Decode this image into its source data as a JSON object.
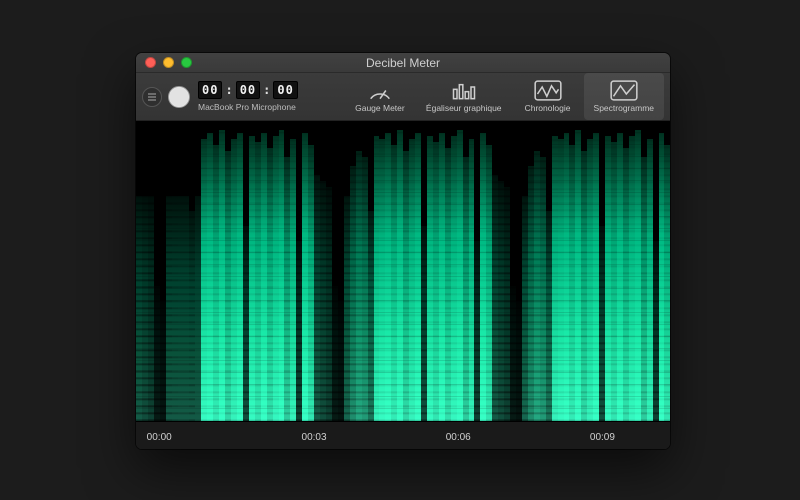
{
  "window": {
    "title": "Decibel Meter"
  },
  "toolbar": {
    "timer": {
      "hh": "00",
      "mm": "00",
      "ss": "00",
      "sep": ":"
    },
    "source_label": "MacBook Pro Microphone"
  },
  "tabs": [
    {
      "id": "gauge",
      "label": "Gauge Meter",
      "icon": "gauge-icon",
      "active": false
    },
    {
      "id": "equalizer",
      "label": "Égaliseur graphique",
      "icon": "bars-icon",
      "active": false
    },
    {
      "id": "chronology",
      "label": "Chronologie",
      "icon": "wave-icon",
      "active": false
    },
    {
      "id": "spectrogram",
      "label": "Spectrogramme",
      "icon": "spectro-icon",
      "active": true
    }
  ],
  "timeline": {
    "ticks": [
      {
        "label": "00:00",
        "pos_pct": 2
      },
      {
        "label": "00:03",
        "pos_pct": 31
      },
      {
        "label": "00:06",
        "pos_pct": 58
      },
      {
        "label": "00:09",
        "pos_pct": 85
      }
    ]
  },
  "spectrogram": {
    "columns": 90,
    "pattern": [
      {
        "cut": 18,
        "a": 0.35,
        "n": 0.5
      },
      {
        "cut": 20,
        "a": 0.3,
        "n": 0.55
      },
      {
        "cut": 22,
        "a": 0.25,
        "n": 0.6
      },
      {
        "cut": 55,
        "a": 0.1,
        "n": 0.7
      },
      {
        "cut": 60,
        "a": 0.08,
        "n": 0.75
      },
      {
        "cut": 25,
        "a": 0.4,
        "n": 0.45
      },
      {
        "cut": 15,
        "a": 0.55,
        "n": 0.35
      },
      {
        "cut": 10,
        "a": 0.65,
        "n": 0.3
      },
      {
        "cut": 12,
        "a": 0.6,
        "n": 0.3
      },
      {
        "cut": 30,
        "a": 0.45,
        "n": 0.4
      },
      {
        "cut": 5,
        "a": 0.95,
        "n": 0.15
      },
      {
        "cut": 6,
        "a": 0.98,
        "n": 0.12
      },
      {
        "cut": 4,
        "a": 1.0,
        "n": 0.1
      },
      {
        "cut": 8,
        "a": 0.92,
        "n": 0.15
      },
      {
        "cut": 3,
        "a": 1.0,
        "n": 0.08
      },
      {
        "cut": 10,
        "a": 0.85,
        "n": 0.2
      },
      {
        "cut": 6,
        "a": 0.95,
        "n": 0.12
      },
      {
        "cut": 4,
        "a": 1.0,
        "n": 0.1
      },
      {
        "cut": 35,
        "a": 0.3,
        "n": 0.5
      },
      {
        "cut": 5,
        "a": 0.98,
        "n": 0.1
      },
      {
        "cut": 7,
        "a": 0.9,
        "n": 0.15
      },
      {
        "cut": 4,
        "a": 1.0,
        "n": 0.08
      },
      {
        "cut": 9,
        "a": 0.88,
        "n": 0.18
      },
      {
        "cut": 5,
        "a": 0.97,
        "n": 0.1
      },
      {
        "cut": 3,
        "a": 1.0,
        "n": 0.07
      },
      {
        "cut": 12,
        "a": 0.8,
        "n": 0.22
      },
      {
        "cut": 6,
        "a": 0.95,
        "n": 0.12
      },
      {
        "cut": 40,
        "a": 0.25,
        "n": 0.55
      },
      {
        "cut": 4,
        "a": 1.0,
        "n": 0.08
      },
      {
        "cut": 8,
        "a": 0.9,
        "n": 0.16
      }
    ]
  }
}
